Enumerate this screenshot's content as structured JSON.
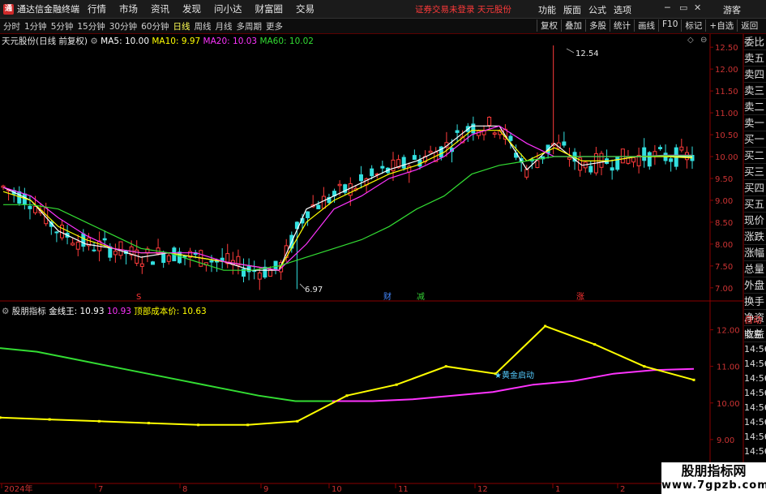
{
  "app": {
    "title": "通达信金融终端"
  },
  "menu": [
    "行情",
    "市场",
    "资讯",
    "发现",
    "问小达",
    "财富圈",
    "交易"
  ],
  "status": {
    "text": "证券交易未登录  天元股份"
  },
  "right_menu": [
    "功能",
    "版面",
    "公式",
    "选项"
  ],
  "guest": "游客",
  "periods": [
    "分时",
    "1分钟",
    "5分钟",
    "15分钟",
    "30分钟",
    "60分钟",
    "日线",
    "周线",
    "月线",
    "多周期",
    "更多"
  ],
  "active_period": "日线",
  "tools": [
    "复权",
    "叠加",
    "多股",
    "统计",
    "画线",
    "F10",
    "标记",
    "+自选",
    "返回"
  ],
  "main_chart": {
    "stock_label": "天元股份(日线 前复权)",
    "ma": [
      {
        "label": "MA5: 10.00",
        "color": "#ffffff"
      },
      {
        "label": "MA10: 9.97",
        "color": "#ffff00"
      },
      {
        "label": "MA20: 10.03",
        "color": "#ff33ff"
      },
      {
        "label": "MA60: 10.02",
        "color": "#33dd33"
      }
    ],
    "high_label": "12.54",
    "low_label": "6.97",
    "markers": [
      {
        "text": "S",
        "color": "#ff3333"
      },
      {
        "text": "财",
        "color": "#4488ff"
      },
      {
        "text": "减",
        "color": "#33cc33"
      },
      {
        "text": "涨",
        "color": "#ff3333"
      }
    ]
  },
  "sidebar": [
    "委比",
    "卖五",
    "卖四",
    "卖三",
    "卖二",
    "卖一",
    "买一",
    "买二",
    "买三",
    "买四",
    "买五",
    "现价",
    "涨跌",
    "涨幅",
    "总量",
    "外盘",
    "换手",
    "净资",
    "收益"
  ],
  "sub_chart": {
    "name": "股朋指标",
    "labels": [
      {
        "text": "金线王: 10.93",
        "color": "#ffffff"
      },
      {
        "text": "10.93",
        "color": "#ff33ff"
      },
      {
        "text": "顶部成本价: 10.63",
        "color": "#ffff00"
      }
    ],
    "annotation": "★黄金启动"
  },
  "sidebar2": [
    "自动",
    "交易",
    "14:56",
    "14:56",
    "14:56",
    "14:56",
    "14:56",
    "14:56",
    "14:56",
    "14:56",
    "14:56",
    "14:56"
  ],
  "watermark": {
    "line1": "股朋指标网",
    "line2": "www.7gpzb.com"
  },
  "chart_data": [
    {
      "type": "candlestick",
      "title": "天元股份(日线 前复权)",
      "y_ticks": [
        7.0,
        7.5,
        8.0,
        8.5,
        9.0,
        9.5,
        10.0,
        10.5,
        11.0,
        11.5,
        12.0,
        12.5
      ],
      "ylim": [
        6.7,
        12.8
      ],
      "x_labels": [
        "2024年",
        "7",
        "8",
        "9",
        "10",
        "11",
        "12",
        "1",
        "2"
      ],
      "grid": false,
      "series": [
        {
          "name": "MA5",
          "color": "#ffffff",
          "values": [
            9.3,
            9.0,
            8.3,
            8.0,
            7.9,
            7.7,
            7.8,
            7.7,
            7.6,
            7.4,
            7.4,
            8.8,
            9.1,
            9.4,
            9.7,
            9.9,
            10.2,
            10.7,
            10.7,
            9.7,
            10.3,
            9.8,
            9.9,
            10.0,
            10.0,
            10.0
          ]
        },
        {
          "name": "MA10",
          "color": "#ffff00",
          "values": [
            9.2,
            9.0,
            8.4,
            8.1,
            7.9,
            7.8,
            7.8,
            7.7,
            7.6,
            7.5,
            7.4,
            8.5,
            9.0,
            9.3,
            9.6,
            9.8,
            10.1,
            10.6,
            10.6,
            9.9,
            10.2,
            9.9,
            9.9,
            10.0,
            10.0,
            9.97
          ]
        },
        {
          "name": "MA20",
          "color": "#ff33ff",
          "values": [
            9.3,
            9.1,
            8.6,
            8.2,
            7.9,
            7.8,
            7.8,
            7.8,
            7.6,
            7.5,
            7.4,
            8.0,
            8.8,
            9.1,
            9.5,
            9.7,
            10.0,
            10.5,
            10.7,
            10.3,
            10.0,
            10.0,
            10.0,
            10.0,
            10.03,
            10.03
          ]
        },
        {
          "name": "MA60",
          "color": "#33dd33",
          "values": [
            8.9,
            8.9,
            8.8,
            8.5,
            8.2,
            7.9,
            7.8,
            7.6,
            7.4,
            7.4,
            7.5,
            7.7,
            7.9,
            8.1,
            8.4,
            8.8,
            9.1,
            9.6,
            9.8,
            9.9,
            10.0,
            10.0,
            10.0,
            10.0,
            10.02,
            10.02
          ]
        }
      ]
    },
    {
      "type": "line",
      "title": "股朋指标",
      "y_ticks": [
        8.0,
        9.0,
        10.0,
        11.0,
        12.0
      ],
      "ylim": [
        7.8,
        12.5
      ],
      "series": [
        {
          "name": "金线王",
          "color": "#33dd33",
          "values": [
            11.5,
            11.4,
            11.2,
            11.0,
            10.8,
            10.6,
            10.4,
            10.2,
            10.05,
            10.05
          ]
        },
        {
          "name": "金线王",
          "color": "#ff33ff",
          "values": [
            10.05,
            10.05,
            10.1,
            10.2,
            10.3,
            10.5,
            10.6,
            10.8,
            10.9,
            10.93
          ]
        },
        {
          "name": "顶部成本价",
          "color": "#ffff00",
          "values": [
            9.6,
            9.55,
            9.5,
            9.45,
            9.4,
            9.4,
            9.5,
            10.2,
            10.5,
            11.0,
            10.8,
            12.1,
            11.6,
            11.0,
            10.63
          ]
        }
      ]
    }
  ]
}
